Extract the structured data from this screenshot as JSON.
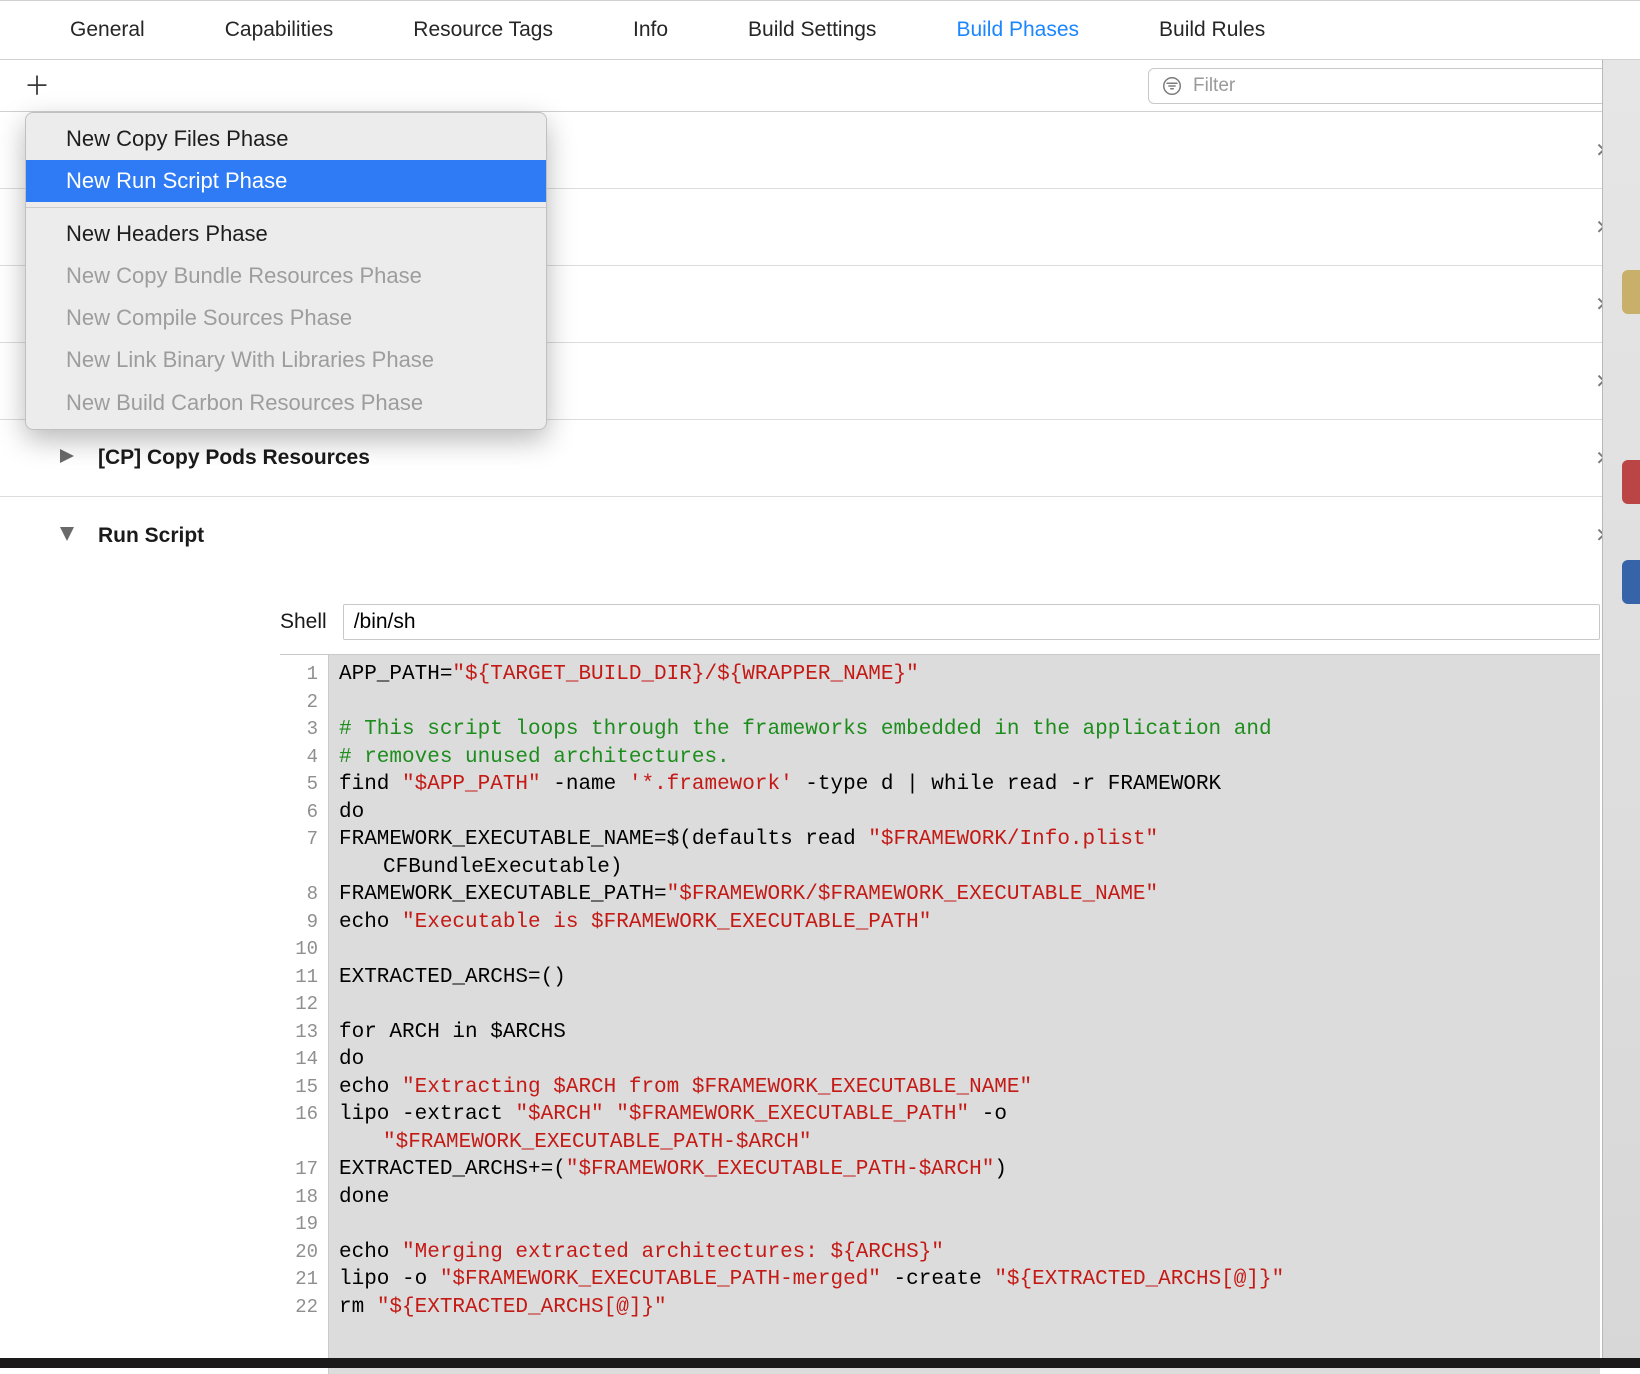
{
  "tabs": {
    "items": [
      "General",
      "Capabilities",
      "Resource Tags",
      "Info",
      "Build Settings",
      "Build Phases",
      "Build Rules"
    ],
    "active_index": 5
  },
  "toolbar": {
    "filter_placeholder": "Filter"
  },
  "popover": {
    "items": [
      {
        "label": "New Copy Files Phase",
        "state": "enabled"
      },
      {
        "label": "New Run Script Phase",
        "state": "selected"
      },
      {
        "label": "sep"
      },
      {
        "label": "New Headers Phase",
        "state": "enabled"
      },
      {
        "label": "New Copy Bundle Resources Phase",
        "state": "disabled"
      },
      {
        "label": "New Compile Sources Phase",
        "state": "disabled"
      },
      {
        "label": "New Link Binary With Libraries Phase",
        "state": "disabled"
      },
      {
        "label": "New Build Carbon Resources Phase",
        "state": "disabled"
      }
    ]
  },
  "hidden_phase_rows": 4,
  "phases": {
    "cp_copy_pods": {
      "title": "[CP] Copy Pods Resources",
      "expanded": false
    },
    "run_script": {
      "title": "Run Script",
      "expanded": true
    }
  },
  "run_script": {
    "shell_label": "Shell",
    "shell_value": "/bin/sh",
    "gutter_lines": 23,
    "code_lines": [
      {
        "t": [
          [
            "kw",
            "APP_PATH="
          ],
          [
            "str",
            "\"${TARGET_BUILD_DIR}/${WRAPPER_NAME}\""
          ]
        ]
      },
      {
        "t": []
      },
      {
        "t": [
          [
            "cmt",
            "# This script loops through the frameworks embedded in the application and"
          ]
        ]
      },
      {
        "t": [
          [
            "cmt",
            "# removes unused architectures."
          ]
        ]
      },
      {
        "t": [
          [
            "kw",
            "find "
          ],
          [
            "str",
            "\"$APP_PATH\""
          ],
          [
            "kw",
            " -name "
          ],
          [
            "str",
            "'*.framework'"
          ],
          [
            "kw",
            " -type d | while read -r FRAMEWORK"
          ]
        ]
      },
      {
        "t": [
          [
            "kw",
            "do"
          ]
        ]
      },
      {
        "t": [
          [
            "kw",
            "FRAMEWORK_EXECUTABLE_NAME=$(defaults read "
          ],
          [
            "str",
            "\"$FRAMEWORK/Info.plist\""
          ]
        ]
      },
      {
        "t": [
          [
            "indent",
            ""
          ],
          [
            "kw",
            "CFBundleExecutable)"
          ]
        ],
        "continuation": true
      },
      {
        "t": [
          [
            "kw",
            "FRAMEWORK_EXECUTABLE_PATH="
          ],
          [
            "str",
            "\"$FRAMEWORK/$FRAMEWORK_EXECUTABLE_NAME\""
          ]
        ]
      },
      {
        "t": [
          [
            "kw",
            "echo "
          ],
          [
            "str",
            "\"Executable is $FRAMEWORK_EXECUTABLE_PATH\""
          ]
        ]
      },
      {
        "t": []
      },
      {
        "t": [
          [
            "kw",
            "EXTRACTED_ARCHS=()"
          ]
        ]
      },
      {
        "t": []
      },
      {
        "t": [
          [
            "kw",
            "for ARCH in $ARCHS"
          ]
        ]
      },
      {
        "t": [
          [
            "kw",
            "do"
          ]
        ]
      },
      {
        "t": [
          [
            "kw",
            "echo "
          ],
          [
            "str",
            "\"Extracting $ARCH from $FRAMEWORK_EXECUTABLE_NAME\""
          ]
        ]
      },
      {
        "t": [
          [
            "kw",
            "lipo -extract "
          ],
          [
            "str",
            "\"$ARCH\" \"$FRAMEWORK_EXECUTABLE_PATH\""
          ],
          [
            "kw",
            " -o"
          ]
        ]
      },
      {
        "t": [
          [
            "indent",
            ""
          ],
          [
            "str",
            "\"$FRAMEWORK_EXECUTABLE_PATH-$ARCH\""
          ]
        ],
        "continuation": true
      },
      {
        "t": [
          [
            "kw",
            "EXTRACTED_ARCHS+=("
          ],
          [
            "str",
            "\"$FRAMEWORK_EXECUTABLE_PATH-$ARCH\""
          ],
          [
            "kw",
            ")"
          ]
        ]
      },
      {
        "t": [
          [
            "kw",
            "done"
          ]
        ]
      },
      {
        "t": []
      },
      {
        "t": [
          [
            "kw",
            "echo "
          ],
          [
            "str",
            "\"Merging extracted architectures: ${ARCHS}\""
          ]
        ]
      },
      {
        "t": [
          [
            "kw",
            "lipo -o "
          ],
          [
            "str",
            "\"$FRAMEWORK_EXECUTABLE_PATH-merged\""
          ],
          [
            "kw",
            " -create "
          ],
          [
            "str",
            "\"${EXTRACTED_ARCHS[@]}\""
          ]
        ]
      },
      {
        "t": [
          [
            "kw",
            "rm "
          ],
          [
            "str",
            "\"${EXTRACTED_ARCHS[@]}\""
          ]
        ]
      }
    ]
  }
}
